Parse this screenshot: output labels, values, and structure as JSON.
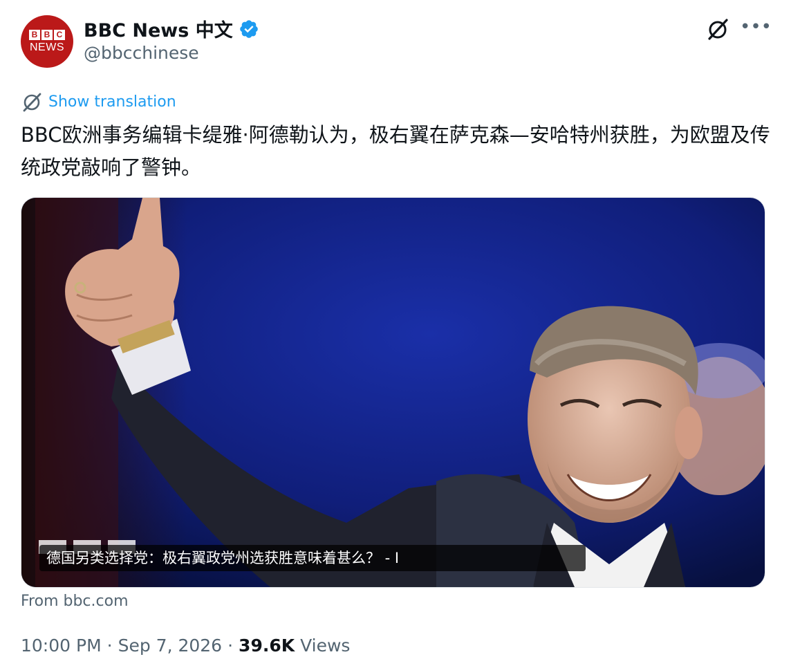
{
  "account": {
    "display_name": "BBC News 中文",
    "handle": "@bbcchinese",
    "avatar_letters": [
      "B",
      "B",
      "C"
    ],
    "avatar_subtitle": "NEWS"
  },
  "tweet": {
    "translate_label": "Show translation",
    "text": "BBC欧洲事务编辑卡缇雅·阿德勒认为，极右翼在萨克森—安哈特州获胜，为欧盟及传统政党敲响了警钟。"
  },
  "media": {
    "caption": "德国另类选择党：极右翼政党州选获胜意味着甚么？ - I"
  },
  "card": {
    "source": "From bbc.com"
  },
  "meta": {
    "time": "10:00 PM",
    "sep1": "·",
    "date": "Sep 7, 2026",
    "sep2": "·",
    "views_count": "39.6K",
    "views_label": "Views"
  },
  "colors": {
    "accent": "#1d9bf0",
    "bbc_red": "#bb1919",
    "muted": "#536471"
  },
  "icons": [
    "verified-badge-icon",
    "grok-icon",
    "more-icon",
    "translate-icon"
  ]
}
